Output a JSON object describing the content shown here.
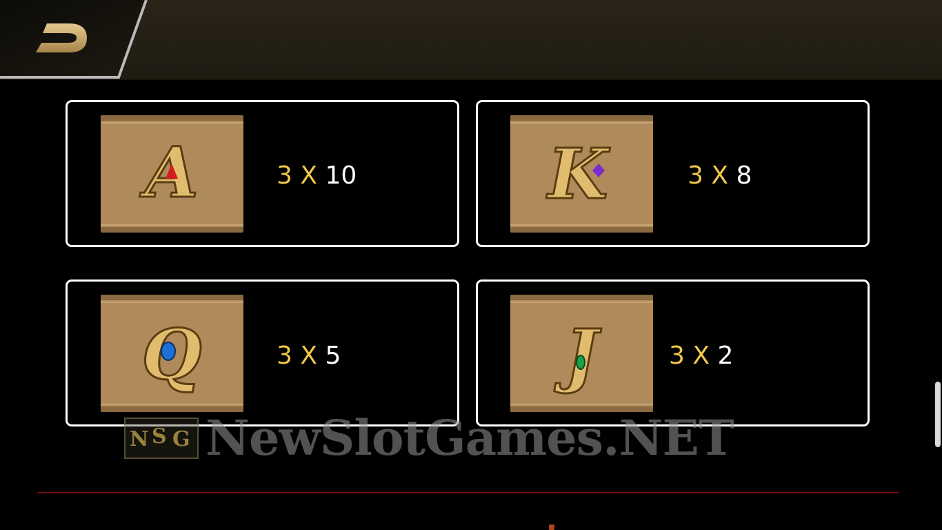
{
  "back_button": {
    "icon": "back-arrow-icon"
  },
  "paytable": [
    {
      "symbol": "A",
      "gem_color": "#d41c1c",
      "multiplier_label": "3 X",
      "value": "10"
    },
    {
      "symbol": "K",
      "gem_color": "#7a2ccf",
      "multiplier_label": "3 X",
      "value": "8"
    },
    {
      "symbol": "Q",
      "gem_color": "#1f6fd6",
      "multiplier_label": "3 X",
      "value": "5"
    },
    {
      "symbol": "J",
      "gem_color": "#1aa24a",
      "multiplier_label": "3 X",
      "value": "2"
    }
  ],
  "watermark": {
    "logo_letters": [
      "N",
      "S",
      "G"
    ],
    "text": "NewSlotGames.NET"
  },
  "colors": {
    "multiplier": "#f3c94a",
    "value": "#ffffff",
    "card_border": "#ffffff",
    "divider": "#6d0d0d",
    "topbar": "#241f15"
  }
}
